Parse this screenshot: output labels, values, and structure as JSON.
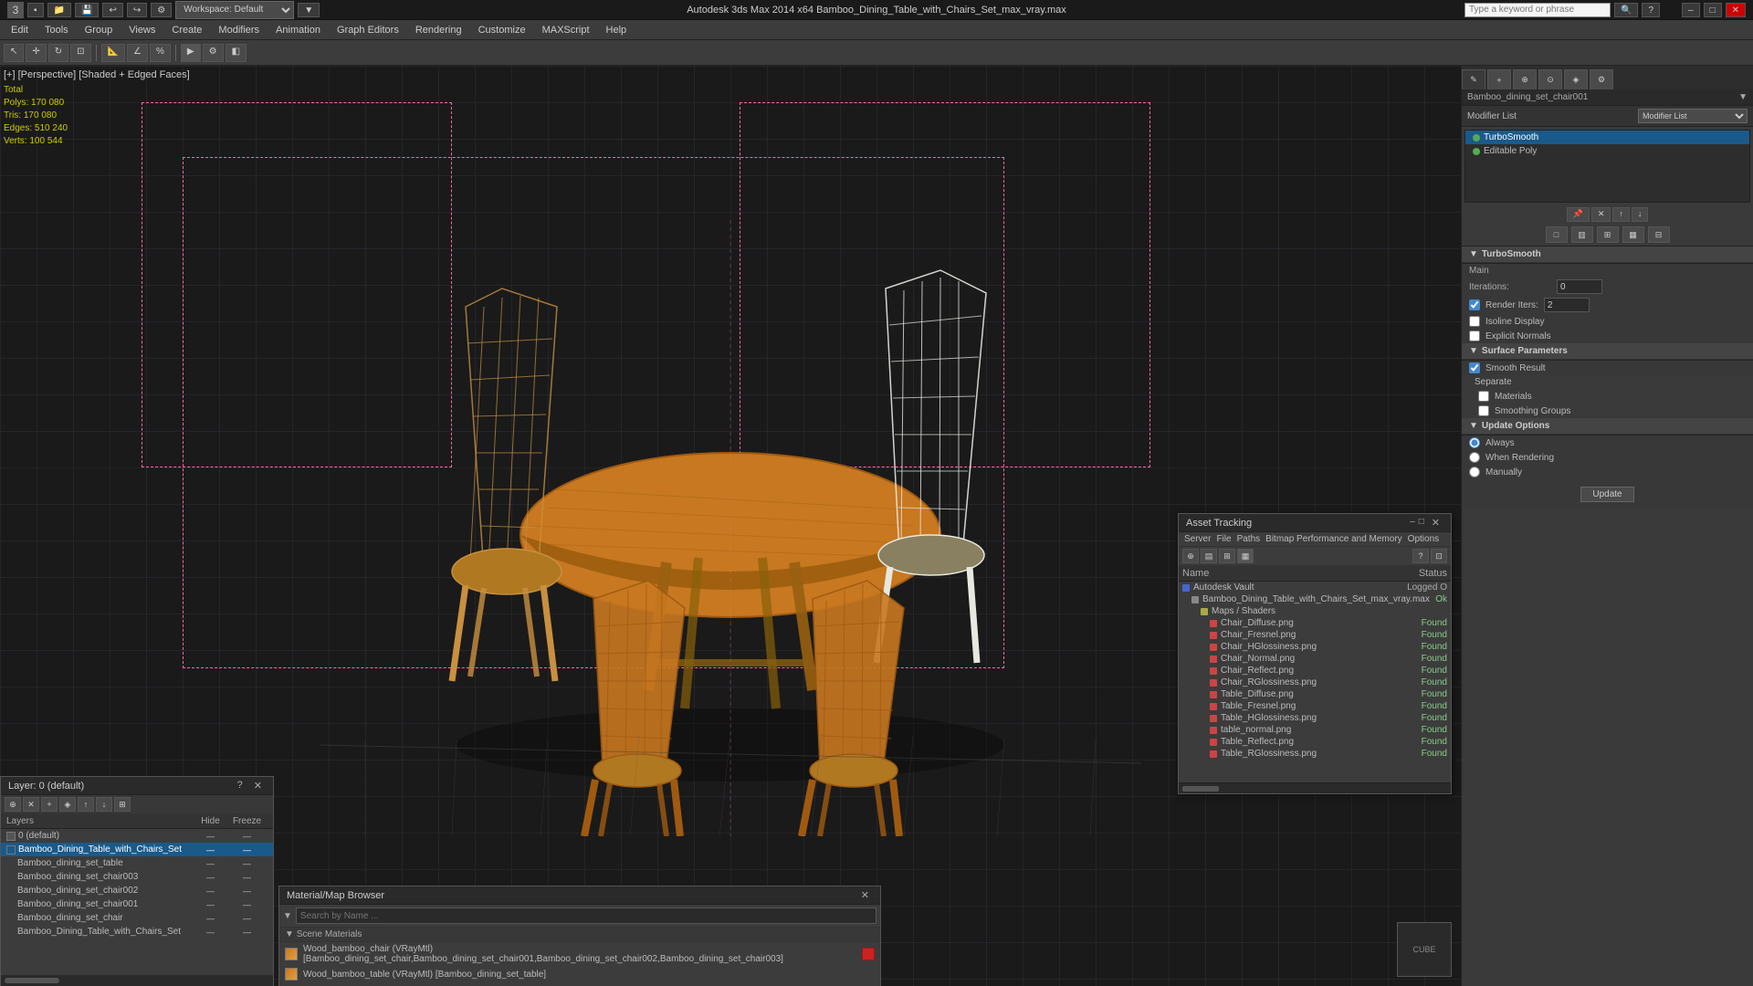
{
  "titlebar": {
    "title": "Autodesk 3ds Max 2014 x64    Bamboo_Dining_Table_with_Chairs_Set_max_vray.max",
    "search_placeholder": "Type a keyword or phrase",
    "workspace": "Workspace: Default",
    "min": "–",
    "max": "□",
    "close": "✕"
  },
  "menu": {
    "items": [
      "Edit",
      "Tools",
      "Group",
      "Views",
      "Create",
      "Modifiers",
      "Animation",
      "Graph Editors",
      "Rendering",
      "Customize",
      "MAXScript",
      "Help"
    ]
  },
  "viewport": {
    "label": "[+] [Perspective] [Shaded + Edged Faces]",
    "stats": {
      "polys": "170 080",
      "tris": "170 080",
      "edges": "510 240",
      "verts": "100 544"
    }
  },
  "right_panel": {
    "object_name": "Bamboo_dining_set_chair001",
    "modifier_list_label": "Modifier List",
    "modifiers": [
      {
        "name": "TurboSmooth",
        "active": true
      },
      {
        "name": "Editable Poly",
        "active": true
      }
    ],
    "sections": {
      "turbosmooth": {
        "label": "TurboSmooth",
        "main": {
          "label": "Main",
          "iterations_label": "Iterations:",
          "iterations_value": "0",
          "render_iters_label": "Render Iters:",
          "render_iters_value": "2",
          "isoline_display": "Isoline Display",
          "explicit_normals": "Explicit Normals"
        },
        "surface": {
          "label": "Surface Parameters",
          "smooth_result": "Smooth Result"
        },
        "separate": {
          "label": "Separate",
          "materials": "Materials",
          "smoothing_groups": "Smoothing Groups"
        },
        "update": {
          "label": "Update Options",
          "always": "Always",
          "when_rendering": "When Rendering",
          "manually": "Manually",
          "update_btn": "Update"
        }
      }
    }
  },
  "asset_tracking": {
    "title": "Asset Tracking",
    "menu": [
      "Server",
      "File",
      "Paths",
      "Bitmap Performance and Memory",
      "Options"
    ],
    "columns": {
      "name": "Name",
      "status": "Status"
    },
    "rows": [
      {
        "indent": 0,
        "icon": "blue",
        "name": "Autodesk Vault",
        "status": "Logged O"
      },
      {
        "indent": 1,
        "icon": "gray",
        "name": "Bamboo_Dining_Table_with_Chairs_Set_max_vray.max",
        "status": "Ok"
      },
      {
        "indent": 2,
        "icon": "yellow",
        "name": "Maps / Shaders",
        "status": ""
      },
      {
        "indent": 3,
        "icon": "gray",
        "name": "Chair_Diffuse.png",
        "status": "Found"
      },
      {
        "indent": 3,
        "icon": "gray",
        "name": "Chair_Fresnel.png",
        "status": "Found"
      },
      {
        "indent": 3,
        "icon": "gray",
        "name": "Chair_HGlossiness.png",
        "status": "Found"
      },
      {
        "indent": 3,
        "icon": "gray",
        "name": "Chair_Normal.png",
        "status": "Found"
      },
      {
        "indent": 3,
        "icon": "gray",
        "name": "Chair_Reflect.png",
        "status": "Found"
      },
      {
        "indent": 3,
        "icon": "gray",
        "name": "Chair_RGlossiness.png",
        "status": "Found"
      },
      {
        "indent": 3,
        "icon": "gray",
        "name": "Table_Diffuse.png",
        "status": "Found"
      },
      {
        "indent": 3,
        "icon": "gray",
        "name": "Table_Fresnel.png",
        "status": "Found"
      },
      {
        "indent": 3,
        "icon": "gray",
        "name": "Table_HGlossiness.png",
        "status": "Found"
      },
      {
        "indent": 3,
        "icon": "gray",
        "name": "table_normal.png",
        "status": "Found"
      },
      {
        "indent": 3,
        "icon": "gray",
        "name": "Table_Reflect.png",
        "status": "Found"
      },
      {
        "indent": 3,
        "icon": "gray",
        "name": "Table_RGlossiness.png",
        "status": "Found"
      }
    ]
  },
  "layers": {
    "title": "Layer: 0 (default)",
    "columns": {
      "name": "Layers",
      "hide": "Hide",
      "freeze": "Freeze"
    },
    "rows": [
      {
        "indent": 0,
        "name": "0 (default)",
        "hide": "—",
        "freeze": "—",
        "active": false
      },
      {
        "indent": 0,
        "name": "Bamboo_Dining_Table_with_Chairs_Set",
        "hide": "—",
        "freeze": "—",
        "active": true
      },
      {
        "indent": 1,
        "name": "Bamboo_dining_set_table",
        "hide": "—",
        "freeze": "—",
        "active": false
      },
      {
        "indent": 1,
        "name": "Bamboo_dining_set_chair003",
        "hide": "—",
        "freeze": "—",
        "active": false
      },
      {
        "indent": 1,
        "name": "Bamboo_dining_set_chair002",
        "hide": "—",
        "freeze": "—",
        "active": false
      },
      {
        "indent": 1,
        "name": "Bamboo_dining_set_chair001",
        "hide": "—",
        "freeze": "—",
        "active": false
      },
      {
        "indent": 1,
        "name": "Bamboo_dining_set_chair",
        "hide": "—",
        "freeze": "—",
        "active": false
      },
      {
        "indent": 1,
        "name": "Bamboo_Dining_Table_with_Chairs_Set",
        "hide": "—",
        "freeze": "—",
        "active": false
      }
    ]
  },
  "material_browser": {
    "title": "Material/Map Browser",
    "search_placeholder": "Search by Name ...",
    "section_label": "Scene Materials",
    "items": [
      {
        "name": "Wood_bamboo_chair (VRayMtl) [Bamboo_dining_set_chair,Bamboo_dining_set_chair001,Bamboo_dining_set_chair002,Bamboo_dining_set_chair003]",
        "swatch": "orange",
        "red_box": true
      },
      {
        "name": "Wood_bamboo_table (VRayMtl) [Bamboo_dining_set_table]",
        "swatch": "orange",
        "red_box": false
      }
    ]
  }
}
